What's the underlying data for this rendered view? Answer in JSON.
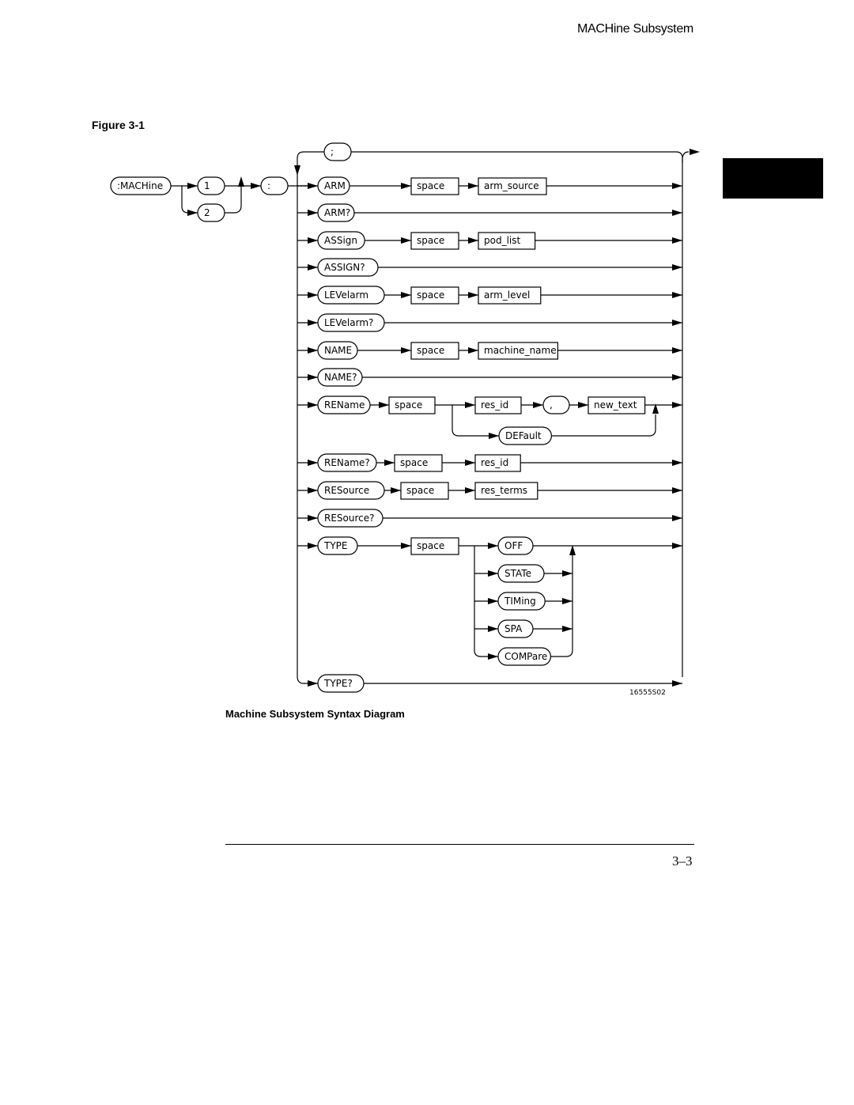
{
  "page": {
    "header": "MACHine Subsystem",
    "figure_label": "Figure 3-1",
    "caption": "Machine Subsystem Syntax Diagram",
    "page_number": "3–3",
    "figure_id": "16555S02"
  },
  "diagram": {
    "start": ":MACHine",
    "machine_numbers": [
      "1",
      "2"
    ],
    "colon": ":",
    "separator": ";",
    "commands": [
      {
        "keyword": "ARM",
        "params": [
          "space",
          "arm_source"
        ]
      },
      {
        "keyword": "ARM?",
        "params": []
      },
      {
        "keyword": "ASSign",
        "params": [
          "space",
          "pod_list"
        ]
      },
      {
        "keyword": "ASSIGN?",
        "params": []
      },
      {
        "keyword": "LEVelarm",
        "params": [
          "space",
          "arm_level"
        ]
      },
      {
        "keyword": "LEVelarm?",
        "params": []
      },
      {
        "keyword": "NAME",
        "params": [
          "space",
          "machine_name"
        ]
      },
      {
        "keyword": "NAME?",
        "params": []
      },
      {
        "keyword": "REName",
        "params": [
          "space",
          "res_id",
          ",",
          "new_text"
        ],
        "alt": "DEFault"
      },
      {
        "keyword": "REName?",
        "params": [
          "space",
          "res_id"
        ]
      },
      {
        "keyword": "RESource",
        "params": [
          "space",
          "res_terms"
        ]
      },
      {
        "keyword": "RESource?",
        "params": []
      },
      {
        "keyword": "TYPE",
        "params": [
          "space"
        ],
        "options": [
          "OFF",
          "STATe",
          "TIMing",
          "SPA",
          "COMPare"
        ]
      },
      {
        "keyword": "TYPE?",
        "params": []
      }
    ]
  }
}
